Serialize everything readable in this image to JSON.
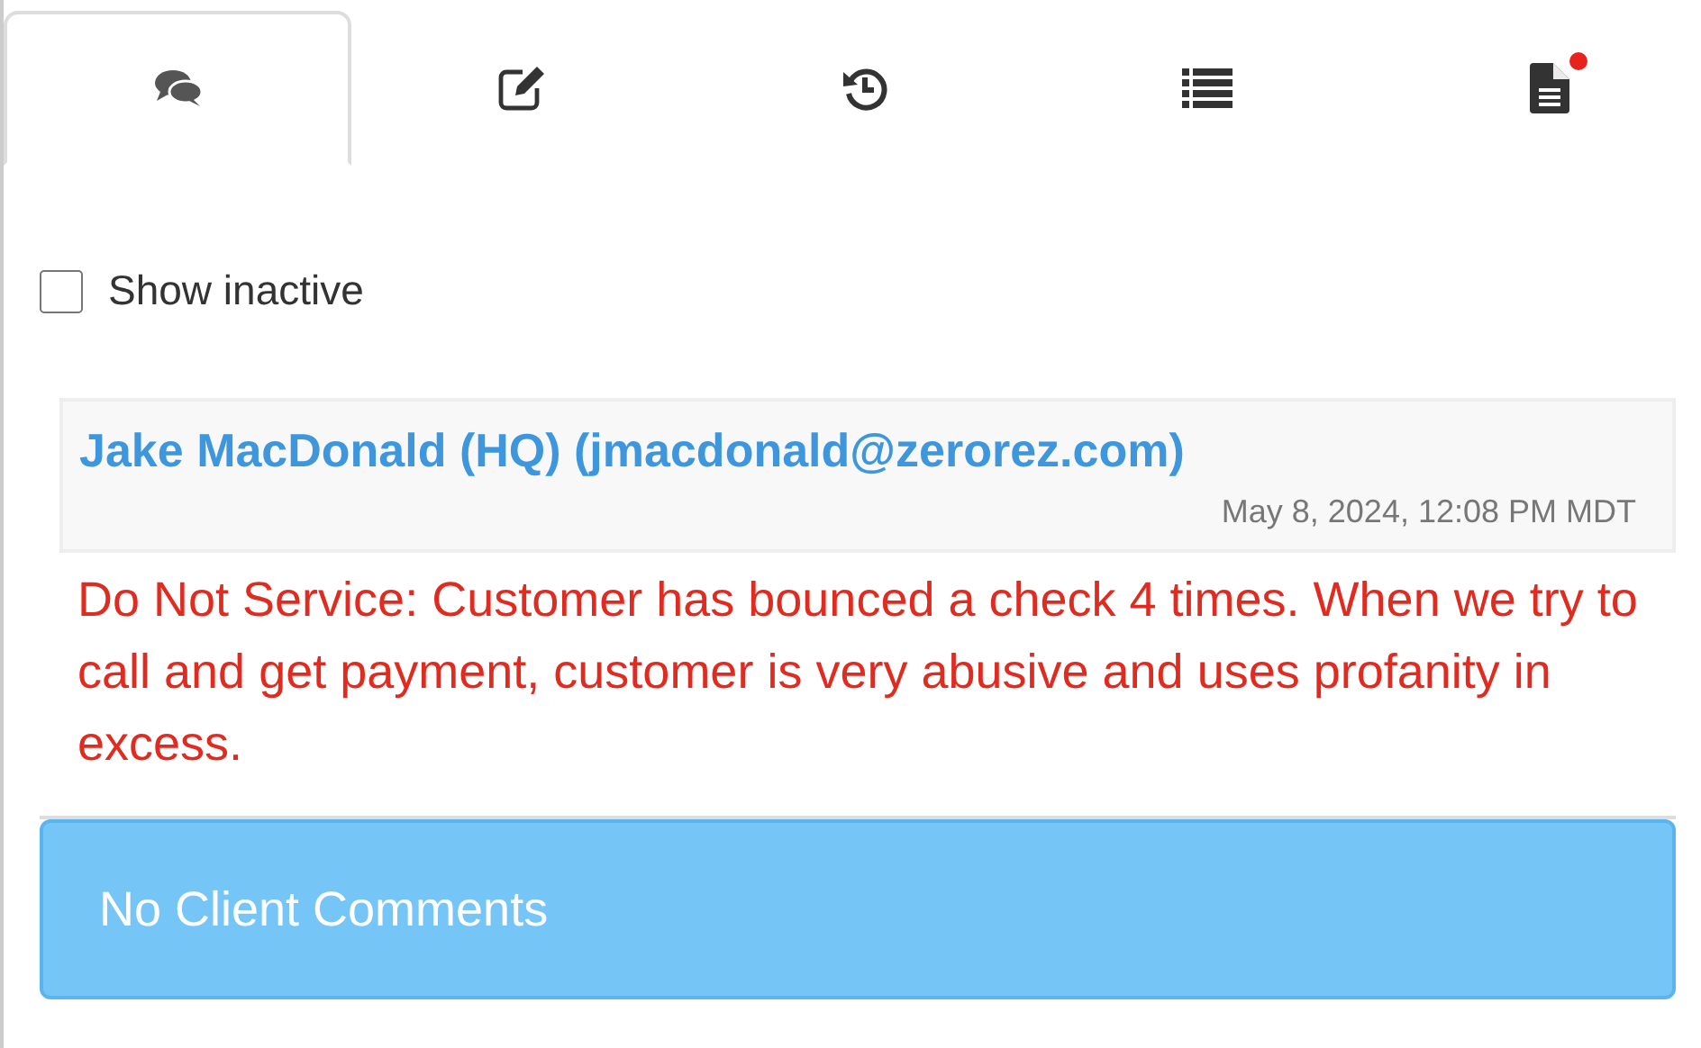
{
  "tabs": [
    {
      "selected": true,
      "alert": false
    },
    {
      "selected": false,
      "alert": false
    },
    {
      "selected": false,
      "alert": false
    },
    {
      "selected": false,
      "alert": false
    },
    {
      "selected": false,
      "alert": true
    }
  ],
  "show_inactive": {
    "label": "Show inactive",
    "checked": false
  },
  "comment": {
    "author": "Jake MacDonald (HQ) (jmacdonald@zerorez.com)",
    "timestamp": "May 8, 2024, 12:08 PM MDT",
    "message": "Do Not Service: Customer has bounced a check 4 times. When we try to call and get payment, customer is very abusive and uses profanity in excess."
  },
  "client_comments": {
    "message": "No Client Comments"
  }
}
